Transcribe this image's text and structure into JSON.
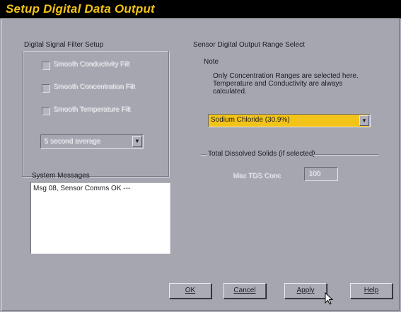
{
  "window": {
    "title": "Setup Digital Data Output"
  },
  "filter_group": {
    "legend": "Digital Signal Filter Setup",
    "checkboxes": [
      {
        "label": "Smooth Conductivity Filt"
      },
      {
        "label": "Smooth Concentration Filt"
      },
      {
        "label": "Smooth Temperature Filt"
      }
    ],
    "select_value": "5 second average"
  },
  "messages": {
    "legend": "System Messages",
    "lines": [
      "Msg 08, Sensor Comms OK  ---"
    ]
  },
  "range_select": {
    "heading": "Sensor Digital Output Range Select",
    "note_label": "Note",
    "note_text": "Only Concentration Ranges are selected here. Temperature and Conductivity are always calculated.",
    "dropdown_value": "Sodium Chloride (30.9%)",
    "dropdown_color": "#f2c318"
  },
  "tds_group": {
    "legend": "Total Dissolved Solids (if selected)",
    "field_label": "Max TDS Conc",
    "field_value": "100"
  },
  "buttons": {
    "ok": "OK",
    "cancel": "Cancel",
    "apply": "Apply",
    "help": "Help"
  }
}
